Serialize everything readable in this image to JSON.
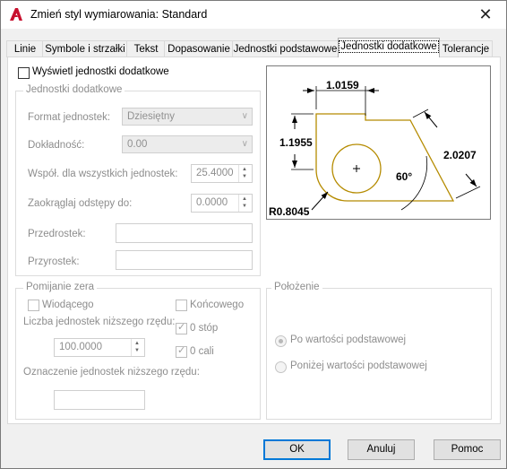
{
  "window": {
    "title": "Zmień styl wymiarowania: Standard",
    "close_glyph": "✕"
  },
  "tabs": [
    {
      "label": "Linie"
    },
    {
      "label": "Symbole i strzałki"
    },
    {
      "label": "Tekst"
    },
    {
      "label": "Dopasowanie"
    },
    {
      "label": "Jednostki podstawowe"
    },
    {
      "label": "Jednostki dodatkowe"
    },
    {
      "label": "Tolerancje"
    }
  ],
  "active_tab": "Jednostki dodatkowe",
  "show_alt_units": {
    "label": "Wyświetl jednostki dodatkowe",
    "checked": false
  },
  "alt_units": {
    "title": "Jednostki dodatkowe",
    "unit_format": {
      "label": "Format jednostek:",
      "value": "Dziesiętny"
    },
    "precision": {
      "label": "Dokładność:",
      "value": "0.00"
    },
    "multiplier": {
      "label": "Współ. dla wszystkich jednostek:",
      "value": "25.4000"
    },
    "round_off": {
      "label": "Zaokrąglaj odstępy do:",
      "value": "0.0000"
    },
    "prefix": {
      "label": "Przedrostek:",
      "value": ""
    },
    "suffix": {
      "label": "Przyrostek:",
      "value": ""
    }
  },
  "zero_suppression": {
    "title": "Pomijanie zera",
    "leading": {
      "label": "Wiodącego",
      "checked": false
    },
    "trailing": {
      "label": "Końcowego",
      "checked": false
    },
    "sub_units_factor": {
      "label": "Liczba jednostek niższego rzędu:",
      "value": "100.0000"
    },
    "feet": {
      "label": "0 stóp",
      "checked": true
    },
    "inches": {
      "label": "0 cali",
      "checked": true
    },
    "sub_unit_suffix": {
      "label": "Oznaczenie jednostek niższego rzędu:",
      "value": ""
    }
  },
  "placement": {
    "title": "Położenie",
    "after_primary": {
      "label": "Po wartości podstawowej",
      "selected": true
    },
    "below_primary": {
      "label": "Poniżej wartości podstawowej",
      "selected": false
    }
  },
  "preview": {
    "dim_top": "1.0159",
    "dim_left": "1.1955",
    "dim_right": "2.0207",
    "dim_angle": "60°",
    "dim_radius": "R0.8045"
  },
  "buttons": {
    "ok": "OK",
    "cancel": "Anuluj",
    "help": "Pomoc"
  },
  "colors": {
    "accent": "#0078d7",
    "logo": "#c8102e",
    "geometry": "#b58b00"
  }
}
